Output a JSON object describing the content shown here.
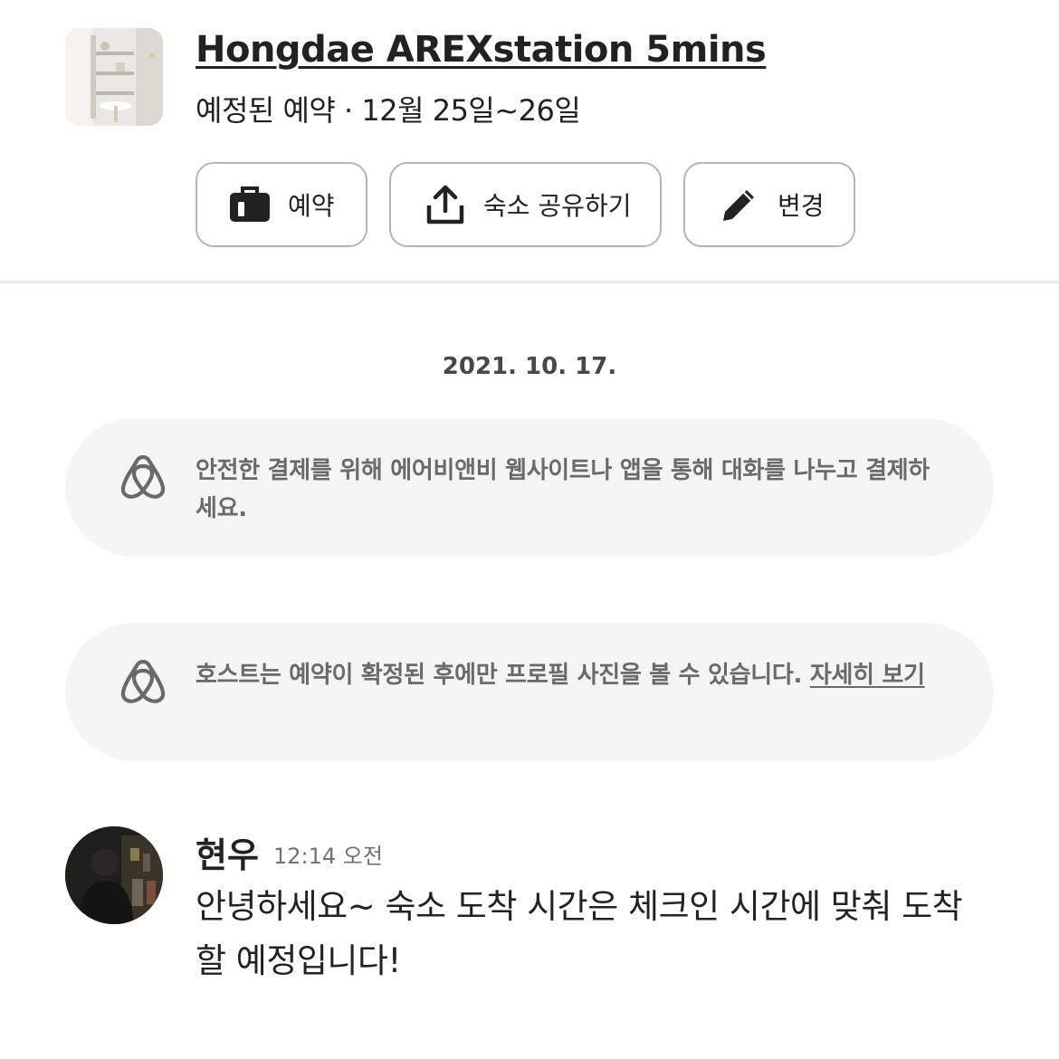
{
  "header": {
    "listing_title": "Hongdae AREXstation 5mins",
    "status": "예정된 예약 · 12월 25일~26일"
  },
  "actions": {
    "trip_label": "예약",
    "share_label": "숙소 공유하기",
    "edit_label": "변경"
  },
  "thread": {
    "date": "2021. 10. 17.",
    "notices": [
      {
        "text": "안전한 결제를 위해 에어비앤비 웹사이트나 앱을 통해 대화를 나누고 결제하세요."
      },
      {
        "text": "호스트는 예약이 확정된 후에만 프로필 사진을 볼 수 있습니다.",
        "link": "자세히 보기"
      }
    ],
    "message": {
      "sender": "현우",
      "time": "12:14 오전",
      "body": "안녕하세요~ 숙소 도착 시간은 체크인 시간에 맞춰 도착할 예정입니다!"
    }
  },
  "colors": {
    "text": "#222222",
    "muted": "#6a6a6a",
    "notice_bg": "#f5f5f5",
    "border": "#b5b5b5"
  }
}
